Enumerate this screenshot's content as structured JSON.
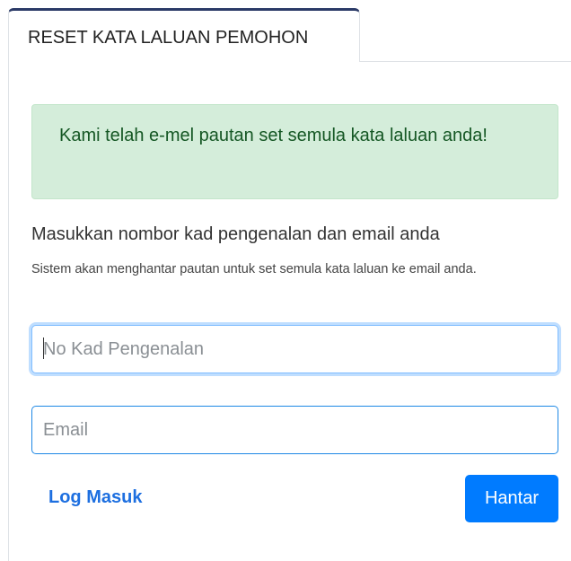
{
  "tab": {
    "label": "RESET KATA LALUAN PEMOHON"
  },
  "alert": {
    "message": "Kami telah e-mel pautan set semula kata laluan anda!"
  },
  "form": {
    "heading": "Masukkan nombor kad pengenalan dan email anda",
    "helper": "Sistem akan menghantar pautan untuk set semula kata laluan ke email anda.",
    "ic_field": {
      "placeholder": "No Kad Pengenalan",
      "value": ""
    },
    "email_field": {
      "placeholder": "Email",
      "value": ""
    },
    "login_link": "Log Masuk",
    "submit_label": "Hantar"
  },
  "colors": {
    "primary": "#007bff",
    "success_bg": "#d4edda",
    "success_text": "#155724",
    "link": "#1d6fe0"
  }
}
